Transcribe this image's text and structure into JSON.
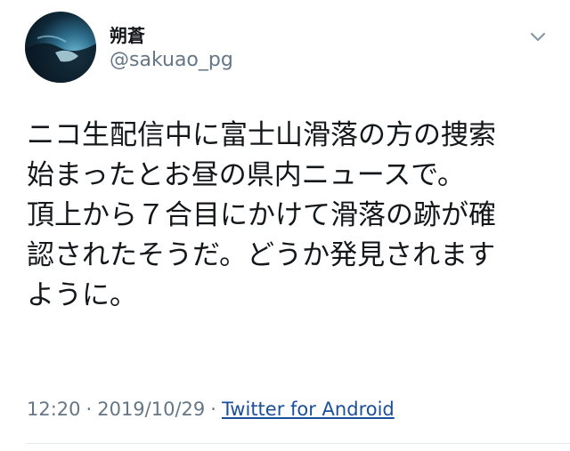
{
  "user": {
    "display_name": "朔蒼",
    "handle": "@sakuao_pg",
    "avatar_icon": "profile-avatar"
  },
  "tweet": {
    "lines": [
      "ニコ生配信中に富士山滑落の方の捜索",
      "始まったとお昼の県内ニュースで。",
      "頂上から７合目にかけて滑落の跡が確",
      "認されたそうだ。どうか発見されます",
      "ように。"
    ]
  },
  "meta": {
    "time": "12:20",
    "separator": "·",
    "date": "2019/10/29",
    "source": "Twitter for Android"
  },
  "colors": {
    "text": "#14171a",
    "secondary": "#657786",
    "link": "#1a4f9c",
    "divider": "#e1e8ed"
  },
  "icons": {
    "menu": "chevron-down-icon"
  }
}
